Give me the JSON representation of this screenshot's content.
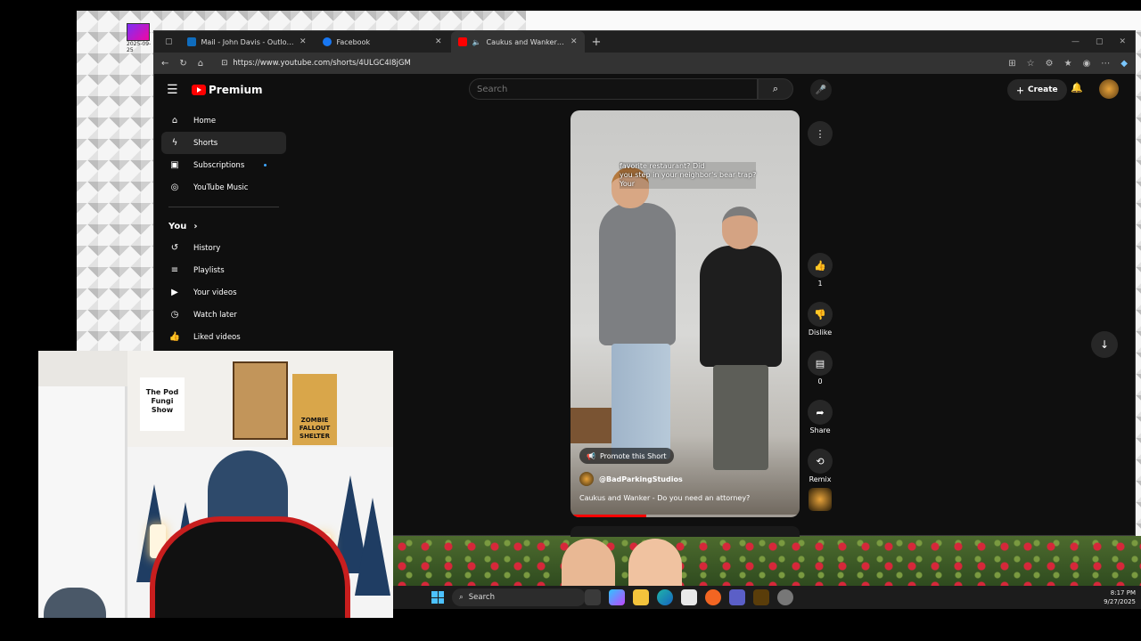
{
  "desktop": {
    "icon_caption": "2025-09-25"
  },
  "browser": {
    "tabs": [
      {
        "title": "Mail - John Davis - Outlook",
        "icon": "outlook-icon",
        "color": "#0f6cbd"
      },
      {
        "title": "Facebook",
        "icon": "facebook-icon",
        "color": "#1877f2"
      },
      {
        "title": "Caukus and Wanker - Do you",
        "icon": "youtube-icon",
        "color": "#ff0000",
        "active": true
      }
    ],
    "new_tab_label": "+",
    "url": "https://www.youtube.com/shorts/4ULGC4I8jGM"
  },
  "youtube": {
    "logo_text": "Premium",
    "search_placeholder": "Search",
    "create_label": "Create",
    "sidebar": {
      "primary": [
        {
          "label": "Home",
          "icon": "home-icon"
        },
        {
          "label": "Shorts",
          "icon": "shorts-icon",
          "selected": true
        },
        {
          "label": "Subscriptions",
          "icon": "subscriptions-icon"
        },
        {
          "label": "YouTube Music",
          "icon": "youtube-music-icon"
        }
      ],
      "you_label": "You",
      "you_items": [
        {
          "label": "History",
          "icon": "history-icon"
        },
        {
          "label": "Playlists",
          "icon": "playlists-icon"
        },
        {
          "label": "Your videos",
          "icon": "your-videos-icon"
        },
        {
          "label": "Watch later",
          "icon": "watch-later-icon"
        },
        {
          "label": "Liked videos",
          "icon": "liked-videos-icon"
        }
      ]
    },
    "short": {
      "caption_line1": "favorite restaurant? Did",
      "caption_line2": "you step in your neighbor's bear trap?",
      "caption_line3": "Your",
      "promote_label": "Promote this Short",
      "channel": "@BadParkingStudios",
      "title": "Caukus and Wanker - Do you need an attorney?",
      "progress_fraction": 0.33
    },
    "actions": {
      "likes": "1",
      "dislike_label": "Dislike",
      "comments": "0",
      "share_label": "Share",
      "remix_label": "Remix"
    }
  },
  "webcam": {
    "poster_text": "The Pod Fungi Show",
    "zombie_text": "ZOMBIE FALLOUT SHELTER"
  },
  "taskbar": {
    "search_label": "Search",
    "time": "8:17 PM",
    "date": "9/27/2025"
  }
}
